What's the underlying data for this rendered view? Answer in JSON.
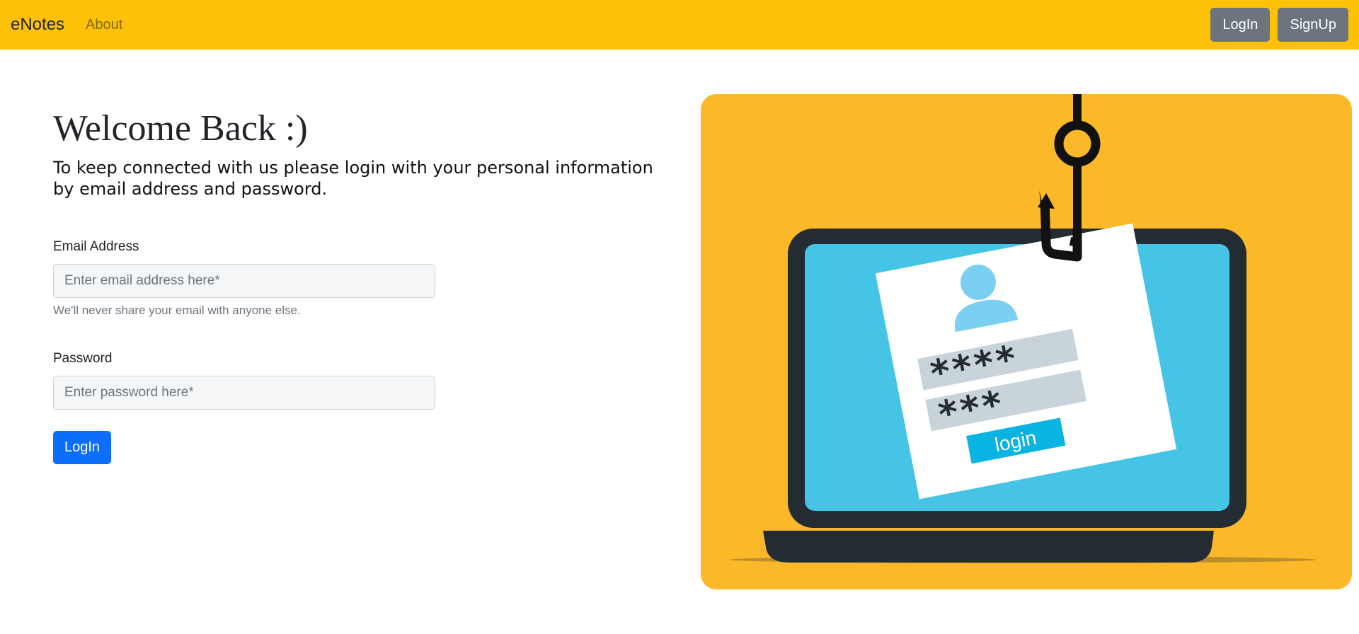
{
  "navbar": {
    "brand": "eNotes",
    "links": [
      {
        "label": "About"
      }
    ],
    "buttons": {
      "login": "LogIn",
      "signup": "SignUp"
    },
    "background_color": "#ffc107"
  },
  "main": {
    "heading": "Welcome Back :)",
    "subtitle": "To keep connected with us please login with your personal information by email address and password.",
    "email": {
      "label": "Email Address",
      "placeholder": "Enter email address here*",
      "value": "",
      "help": "We'll never share your email with anyone else."
    },
    "password": {
      "label": "Password",
      "placeholder": "Enter password here*",
      "value": ""
    },
    "submit_label": "LogIn",
    "submit_color": "#0d6efd"
  },
  "illustration": {
    "icon": "phishing-laptop-illustration",
    "background_color": "#fbb829",
    "password_masks": [
      "****",
      "***"
    ],
    "login_button_text": "login"
  }
}
